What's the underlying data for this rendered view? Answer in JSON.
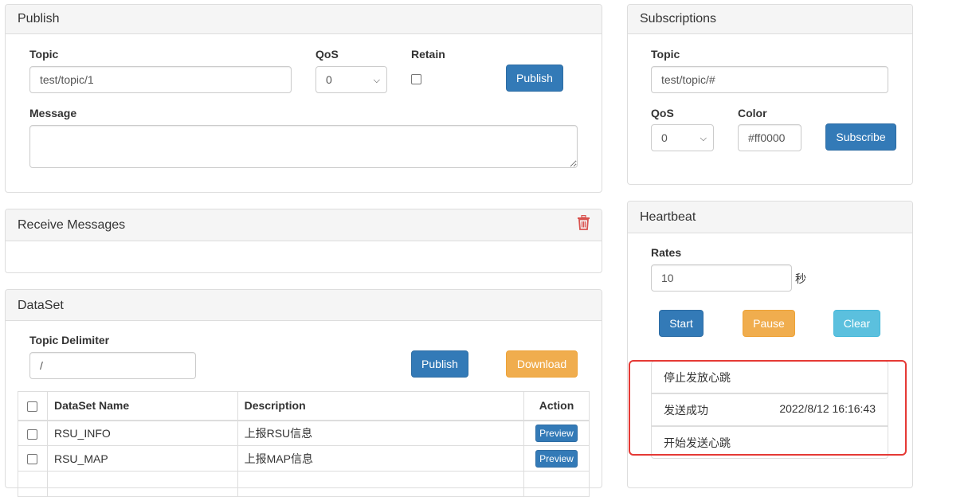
{
  "publish": {
    "title": "Publish",
    "topic_label": "Topic",
    "topic_value": "test/topic/1",
    "qos_label": "QoS",
    "qos_value": "0",
    "retain_label": "Retain",
    "publish_button": "Publish",
    "message_label": "Message",
    "message_value": ""
  },
  "receive": {
    "title": "Receive Messages",
    "trash_icon": "trash-icon",
    "trash_color": "#d9534f"
  },
  "dataset": {
    "title": "DataSet",
    "delimiter_label": "Topic Delimiter",
    "delimiter_value": "/",
    "publish_button": "Publish",
    "download_button": "Download",
    "columns": [
      "DataSet Name",
      "Description",
      "Action"
    ],
    "rows": [
      {
        "name": "RSU_INFO",
        "description": "上报RSU信息",
        "action": "Preview"
      },
      {
        "name": "RSU_MAP",
        "description": "上报MAP信息",
        "action": "Preview"
      }
    ]
  },
  "subscriptions": {
    "title": "Subscriptions",
    "topic_label": "Topic",
    "topic_value": "test/topic/#",
    "qos_label": "QoS",
    "qos_value": "0",
    "color_label": "Color",
    "color_value": "#ff0000",
    "subscribe_button": "Subscribe"
  },
  "heartbeat": {
    "title": "Heartbeat",
    "rates_label": "Rates",
    "rates_value": "10",
    "rates_unit": "秒",
    "start_button": "Start",
    "pause_button": "Pause",
    "clear_button": "Clear",
    "log": [
      {
        "text": "停止发放心跳",
        "time": ""
      },
      {
        "text": "发送成功",
        "time": "2022/8/12 16:16:43"
      },
      {
        "text": "开始发送心跳",
        "time": ""
      }
    ]
  },
  "colors": {
    "primary": "#337ab7",
    "warning": "#f0ad4e",
    "info": "#5bc0de",
    "danger": "#d9534f",
    "highlight_border": "#e53935"
  }
}
